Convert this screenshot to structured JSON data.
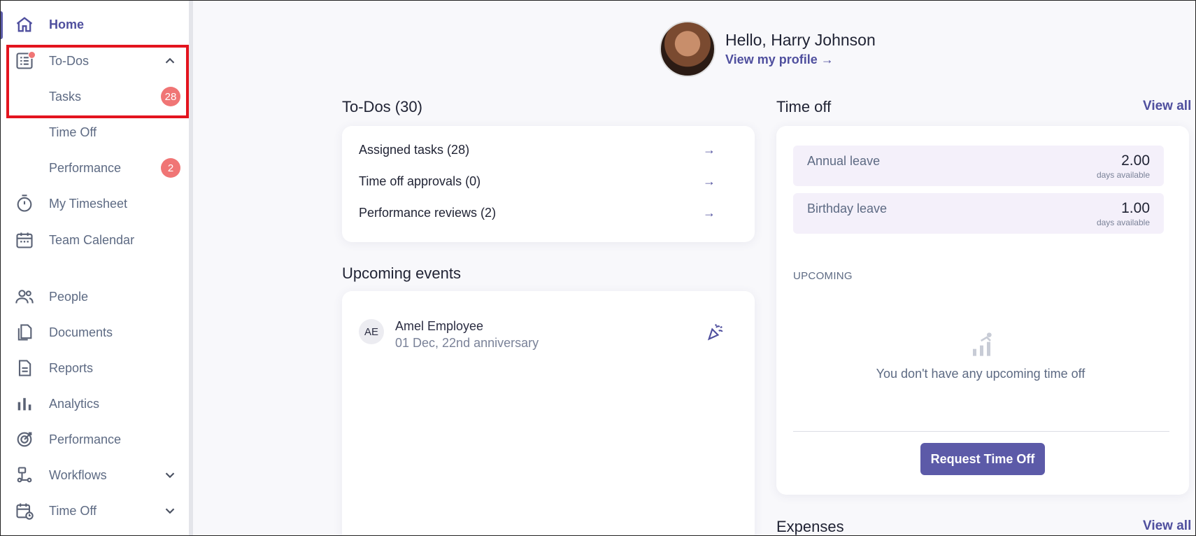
{
  "sidebar": {
    "items": [
      {
        "label": "Home",
        "icon": "home-icon"
      },
      {
        "label": "To-Dos",
        "icon": "todo-list-icon"
      },
      {
        "label": "Tasks",
        "badge": "28"
      },
      {
        "label": "Time Off"
      },
      {
        "label": "Performance",
        "badge": "2"
      },
      {
        "label": "My Timesheet",
        "icon": "stopwatch-icon"
      },
      {
        "label": "Team Calendar",
        "icon": "calendar-icon"
      },
      {
        "label": "People",
        "icon": "people-icon"
      },
      {
        "label": "Documents",
        "icon": "documents-icon"
      },
      {
        "label": "Reports",
        "icon": "report-icon"
      },
      {
        "label": "Analytics",
        "icon": "bar-chart-icon"
      },
      {
        "label": "Performance",
        "icon": "target-icon"
      },
      {
        "label": "Workflows",
        "icon": "workflow-icon"
      },
      {
        "label": "Time Off",
        "icon": "calendar-clock-icon"
      }
    ]
  },
  "greeting": {
    "title": "Hello, Harry Johnson",
    "profile_link": "View my profile →"
  },
  "todos": {
    "title": "To-Dos (30)",
    "rows": [
      {
        "label": "Assigned tasks (28)"
      },
      {
        "label": "Time off approvals (0)"
      },
      {
        "label": "Performance reviews (2)"
      }
    ],
    "arrow": "→"
  },
  "events": {
    "title": "Upcoming events",
    "items": [
      {
        "initials": "AE",
        "name": "Amel Employee",
        "detail": "01 Dec, 22nd anniversary"
      }
    ]
  },
  "timeoff": {
    "title": "Time off",
    "view_all": "View all",
    "leaves": [
      {
        "name": "Annual leave",
        "value": "2.00",
        "unit": "days available"
      },
      {
        "name": "Birthday leave",
        "value": "1.00",
        "unit": "days available"
      }
    ],
    "upcoming_label": "UPCOMING",
    "empty_text": "You don't have any upcoming time off",
    "button": "Request Time Off"
  },
  "expenses": {
    "title": "Expenses",
    "view_all": "View all"
  },
  "colors": {
    "accent": "#4f4f9e",
    "badge": "#f07575",
    "highlight": "#e3141e"
  }
}
